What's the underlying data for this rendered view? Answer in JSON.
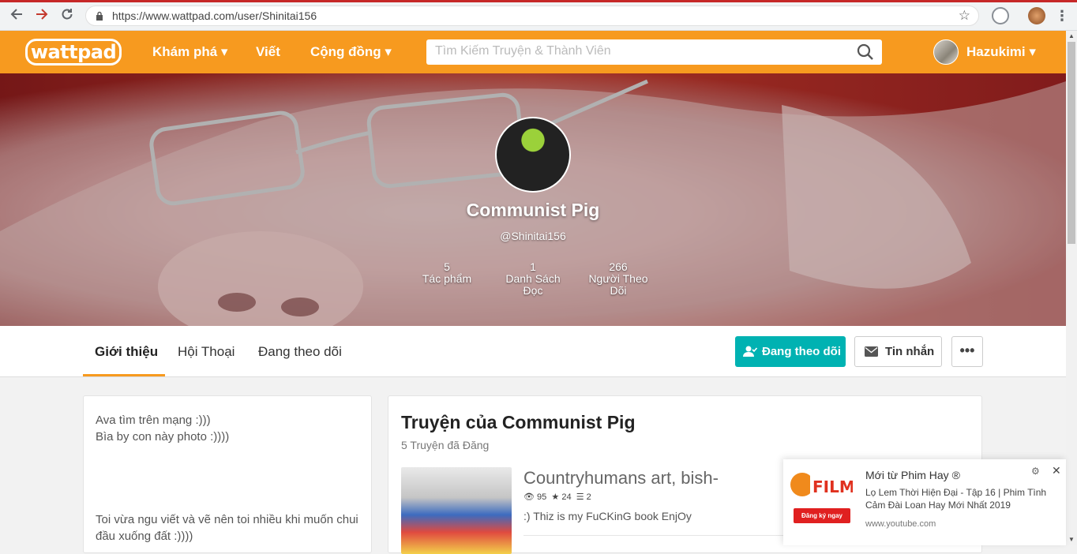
{
  "browser": {
    "url": "https://www.wattpad.com/user/Shinitai156",
    "back_icon": "arrow-left",
    "forward_icon": "arrow-right",
    "reload_icon": "reload"
  },
  "header": {
    "logo": "wattpad",
    "nav": [
      "Khám phá ▾",
      "Viết",
      "Cộng đồng ▾"
    ],
    "search_placeholder": "Tìm Kiếm Truyện & Thành Viên",
    "user_name": "Hazukimi ▾",
    "accent": "#f79a1f"
  },
  "profile": {
    "display_name": "Communist Pig",
    "handle": "@Shinitai156",
    "stats": [
      {
        "value": "5",
        "label": "Tác phẩm"
      },
      {
        "value": "1",
        "label": "Danh Sách Đọc"
      },
      {
        "value": "266",
        "label": "Người Theo Dõi"
      }
    ]
  },
  "tabs": {
    "items": [
      "Giới thiệu",
      "Hội Thoại",
      "Đang theo dõi"
    ],
    "active": "Giới thiệu",
    "following_button": "Đang theo dõi",
    "message_button": "Tin nhắn",
    "more_button": "•••",
    "follow_color": "#00b2b2"
  },
  "about": {
    "lines": [
      "Ava tìm trên mạng :)))",
      "Bìa by con này photo :))))",
      "Toi vừa ngu viết và vẽ nên toi nhiều khi muốn chui",
      "đầu xuống đất :))))"
    ]
  },
  "stories": {
    "title": "Truyện của Communist Pig",
    "subtitle": "5 Truyện đã Đăng",
    "first": {
      "title": "Countryhumans art, bish-",
      "reads": "95",
      "votes": "24",
      "parts": "2",
      "description": ":) Thiz is my FuCKinG book EnjOy"
    }
  },
  "ad": {
    "title": "Mới từ Phim Hay ®",
    "description": "Lọ Lem Thời Hiện Đại - Tập 16 | Phim Tình Cảm Đài Loan Hay Mới Nhất 2019",
    "site": "www.youtube.com",
    "logo_text": "FILM",
    "subscribe": "Đăng ký ngay",
    "close": "✕",
    "gear": "⚙"
  }
}
